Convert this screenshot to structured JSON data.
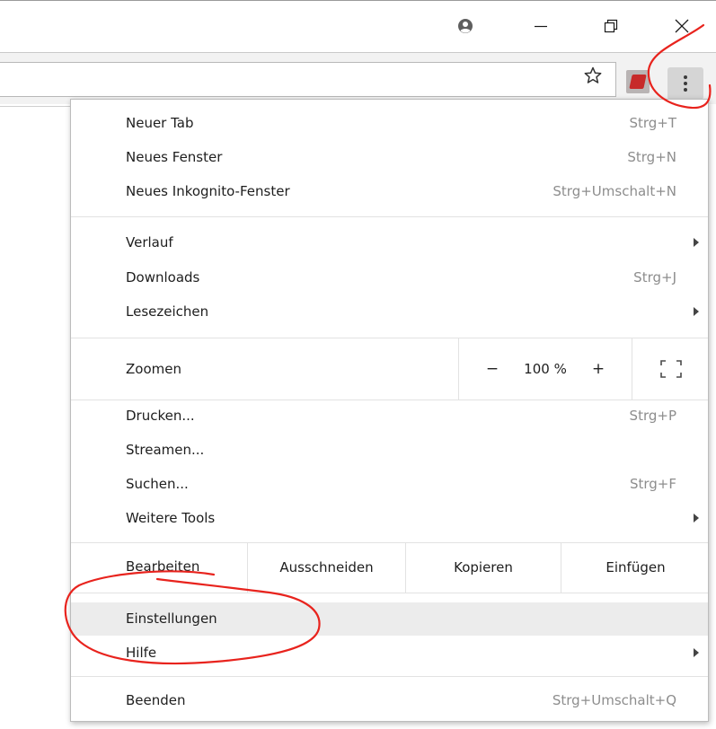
{
  "menu": {
    "items": [
      {
        "label": "Neuer Tab",
        "shortcut": "Strg+T"
      },
      {
        "label": "Neues Fenster",
        "shortcut": "Strg+N"
      },
      {
        "label": "Neues Inkognito-Fenster",
        "shortcut": "Strg+Umschalt+N"
      },
      {
        "label": "Verlauf"
      },
      {
        "label": "Downloads",
        "shortcut": "Strg+J"
      },
      {
        "label": "Lesezeichen"
      },
      {
        "label": "Drucken...",
        "shortcut": "Strg+P"
      },
      {
        "label": "Streamen..."
      },
      {
        "label": "Suchen...",
        "shortcut": "Strg+F"
      },
      {
        "label": "Weitere Tools"
      },
      {
        "label": "Einstellungen"
      },
      {
        "label": "Hilfe"
      },
      {
        "label": "Beenden",
        "shortcut": "Strg+Umschalt+Q"
      }
    ],
    "zoom": {
      "label": "Zoomen",
      "minus": "−",
      "level": "100 %",
      "plus": "+"
    },
    "edit": {
      "label": "Bearbeiten",
      "cut": "Ausschneiden",
      "copy": "Kopieren",
      "paste": "Einfügen"
    }
  },
  "colors": {
    "annotation": "#e8231d",
    "highlight": "#ececec",
    "shortcut_text": "#8d8d8d"
  },
  "icons": [
    "profile-icon",
    "minimize-icon",
    "restore-icon",
    "close-icon",
    "star-icon",
    "extension-icon",
    "menu-dots-icon",
    "fullscreen-icon",
    "submenu-arrow-icon"
  ]
}
